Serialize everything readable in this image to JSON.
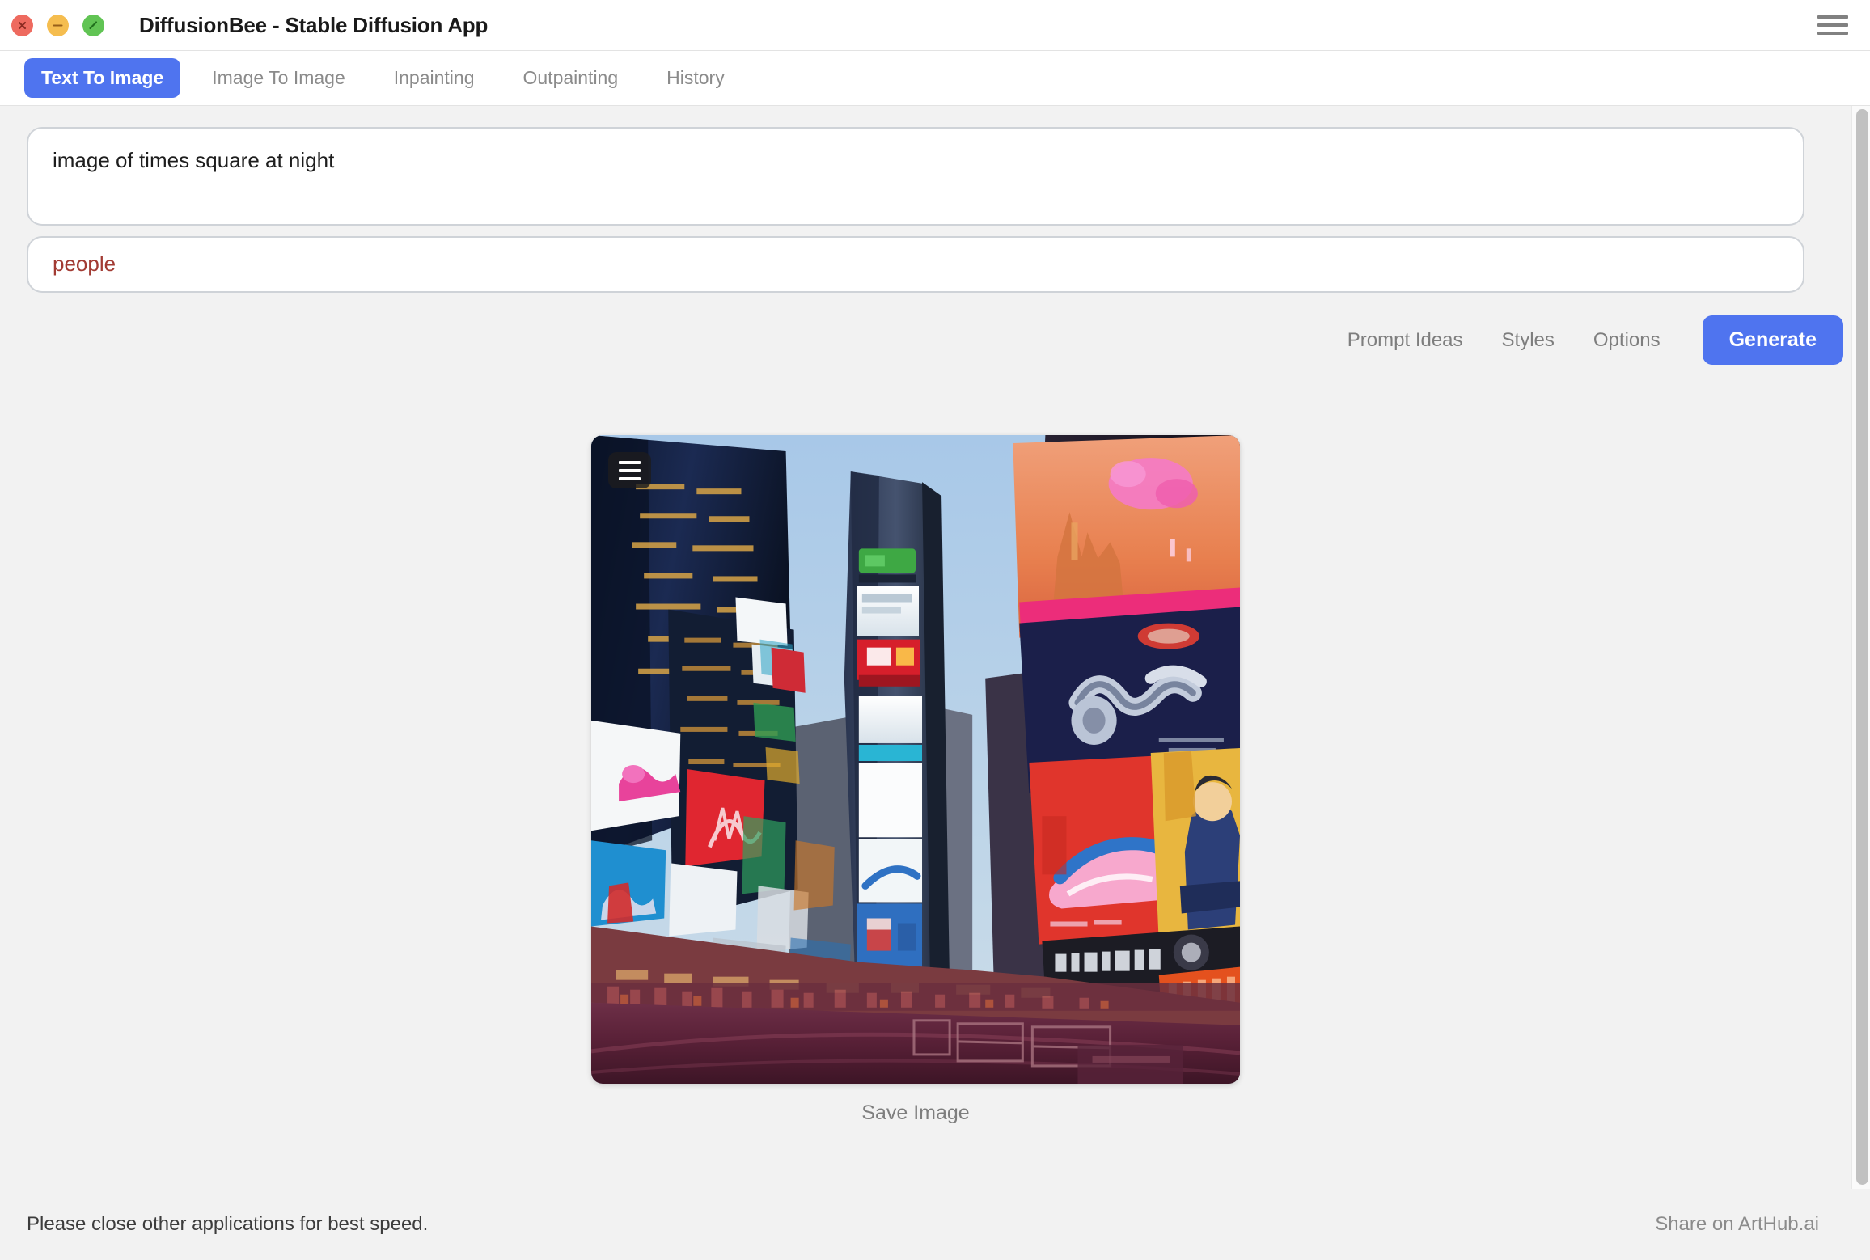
{
  "window": {
    "title": "DiffusionBee - Stable Diffusion App",
    "traffic_lights": [
      {
        "name": "close",
        "color": "#ee6a5f"
      },
      {
        "name": "minimize",
        "color": "#f5bd4f"
      },
      {
        "name": "zoom",
        "color": "#61c454"
      }
    ],
    "menu_icon": "hamburger-icon"
  },
  "tabs": [
    {
      "label": "Text To Image",
      "active": true
    },
    {
      "label": "Image To Image",
      "active": false
    },
    {
      "label": "Inpainting",
      "active": false
    },
    {
      "label": "Outpainting",
      "active": false
    },
    {
      "label": "History",
      "active": false
    }
  ],
  "prompt": {
    "value": "image of times square at night",
    "placeholder": "Enter a prompt"
  },
  "negative_prompt": {
    "value": "people",
    "placeholder": "Negative prompt",
    "color": "#a23b33"
  },
  "actions": {
    "prompt_ideas_label": "Prompt Ideas",
    "styles_label": "Styles",
    "options_label": "Options",
    "generate_label": "Generate",
    "generate_color": "#4f74ef"
  },
  "result": {
    "image_alt": "Generated image of Times Square at night with skyscrapers and illuminated billboards",
    "overlay_menu_icon": "hamburger-icon",
    "save_label": "Save Image"
  },
  "footer": {
    "note": "Please close other applications for best speed.",
    "share_link": "Share on ArtHub.ai"
  }
}
